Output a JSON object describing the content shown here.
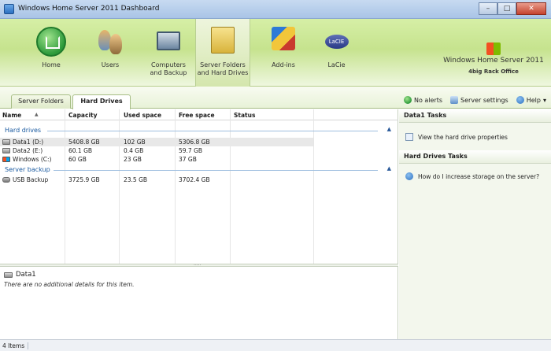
{
  "window": {
    "title": "Windows Home Server 2011 Dashboard",
    "buttons": {
      "minimize": "–",
      "maximize": "□",
      "close": "✕"
    }
  },
  "launchpad": {
    "items": [
      {
        "label": "Home",
        "icon": "home-icon"
      },
      {
        "label": "Users",
        "icon": "users-icon"
      },
      {
        "label": "Computers\nand Backup",
        "icon": "computer-icon"
      },
      {
        "label": "Server Folders\nand Hard Drives",
        "icon": "folders-icon"
      },
      {
        "label": "Add-ins",
        "icon": "addins-icon"
      },
      {
        "label": "LaCie",
        "icon": "lacie-icon"
      }
    ],
    "lacie_badge": "LaCIE",
    "brand": {
      "name": "Windows Home Server 2011",
      "subtitle": "4big Rack Office"
    }
  },
  "tabs": [
    {
      "label": "Server Folders"
    },
    {
      "label": "Hard Drives"
    }
  ],
  "toolbar": {
    "alerts": "No alerts",
    "settings": "Server settings",
    "help": "Help"
  },
  "table": {
    "columns": [
      "Name",
      "Capacity",
      "Used space",
      "Free space",
      "Status"
    ],
    "groups": [
      {
        "name": "Hard drives",
        "rows": [
          {
            "name": "Data1 (D:)",
            "capacity": "5408.8 GB",
            "used": "102 GB",
            "free": "5306.8 GB",
            "status": ""
          },
          {
            "name": "Data2 (E:)",
            "capacity": "60.1 GB",
            "used": "0.4 GB",
            "free": "59.7 GB",
            "status": ""
          },
          {
            "name": "Windows (C:)",
            "capacity": "60 GB",
            "used": "23 GB",
            "free": "37 GB",
            "status": ""
          }
        ]
      },
      {
        "name": "Server backup",
        "rows": [
          {
            "name": "USB Backup",
            "capacity": "3725.9 GB",
            "used": "23.5 GB",
            "free": "3702.4 GB",
            "status": ""
          }
        ]
      }
    ]
  },
  "details": {
    "title": "Data1",
    "message": "There are no additional details for this item."
  },
  "tasks": {
    "item_header": "Data1 Tasks",
    "item_tasks": [
      "View the hard drive properties"
    ],
    "global_header": "Hard Drives Tasks",
    "global_tasks": [
      "How do I increase storage on the server?"
    ]
  },
  "status": {
    "count": "4 Items"
  }
}
